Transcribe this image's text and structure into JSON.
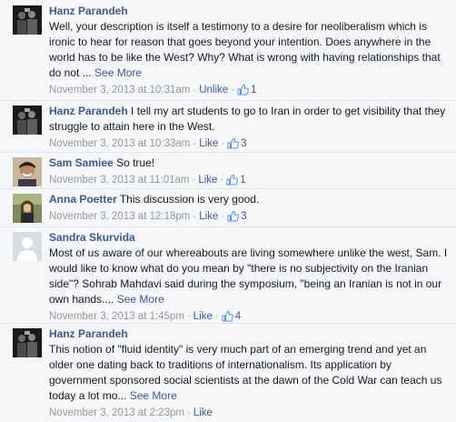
{
  "comments": [
    {
      "author": "Hanz Parandeh",
      "text": "Well, your description is itself a testimony to a desire for neoliberalism which is ironic to hear for reason that goes beyond your intention. Does anywhere in the world has to be like the West? Why? What is wrong with having relationships that do not",
      "ellipsis": " ... ",
      "see_more": "See More",
      "timestamp": "November 3, 2013 at 10:31am",
      "like_action": "Unlike",
      "like_count": "1",
      "avatar": "dark-group-photo"
    },
    {
      "author": "Hanz Parandeh",
      "text": "I tell my art students to go to Iran in order to get visibility that they struggle to attain here in the West.",
      "timestamp": "November 3, 2013 at 10:33am",
      "like_action": "Like",
      "like_count": "3",
      "avatar": "dark-group-photo"
    },
    {
      "author": "Sam Samiee",
      "text": "So true!",
      "timestamp": "November 3, 2013 at 11:01am",
      "like_action": "Like",
      "like_count": "1",
      "avatar": "smiling-man-photo"
    },
    {
      "author": "Anna Poetter",
      "text": "This discussion is very good.",
      "timestamp": "November 3, 2013 at 12:18pm",
      "like_action": "Like",
      "like_count": "3",
      "avatar": "woman-outdoor-photo"
    },
    {
      "author": "Sandra Skurvida",
      "text": "Most of us aware of our whereabouts are living somewhere unlike the west, Sam. I would like to know what do you mean by \"there is no subjectivity on the Iranian side\"? Sohrab Mahdavi said during the symposium, \"being an Iranian is not in our own hands....",
      "ellipsis": " ",
      "see_more": "See More",
      "timestamp": "November 3, 2013 at 1:45pm",
      "like_action": "Like",
      "like_count": "4",
      "avatar": "default-silhouette"
    },
    {
      "author": "Hanz Parandeh",
      "text": "This notion of \"fluid identity\" is very much part of an emerging trend and yet an older one dating back to traditions of internationalism. Its application by government sponsored social scientists at the dawn of the Cold War can teach us today a lot mo",
      "ellipsis": "... ",
      "see_more": "See More",
      "timestamp": "November 3, 2013 at 2:23pm",
      "like_action": "Like",
      "avatar": "dark-group-photo"
    }
  ],
  "colors": {
    "link": "#3b5998",
    "meta": "#9197a3",
    "text": "#141823",
    "background": "#f6f7f9"
  }
}
